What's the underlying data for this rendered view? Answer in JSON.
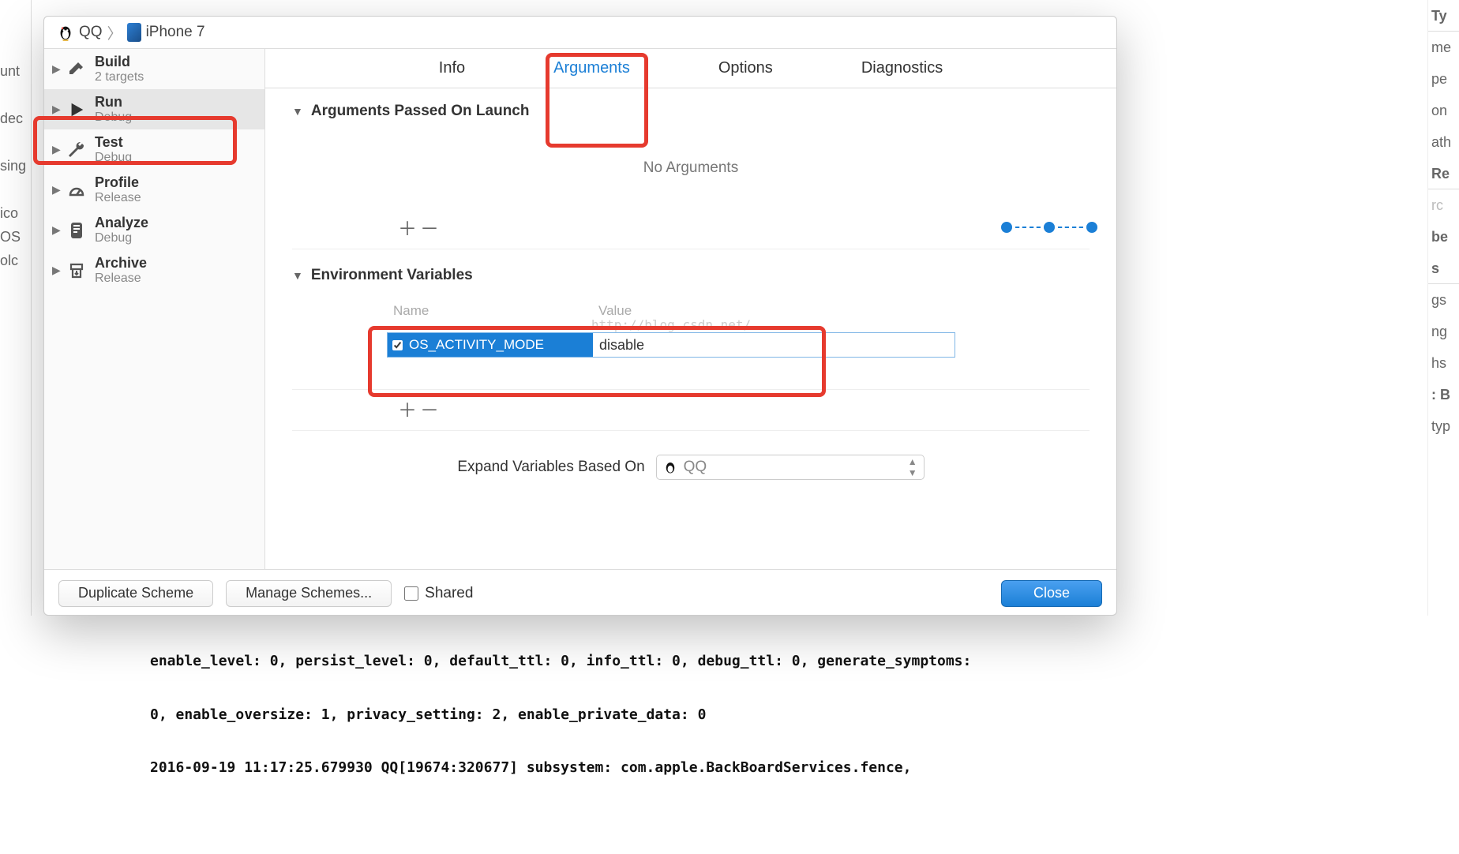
{
  "bg_left": [
    "unt",
    "dec",
    "sing",
    "ico",
    "OS",
    "olc"
  ],
  "bg_right": [
    "Ty",
    "me",
    "pe",
    "on",
    "ath",
    "Re",
    "rc",
    "be",
    "s",
    "gs",
    "ng",
    "hs",
    ": B",
    "typ"
  ],
  "breadcrumb": {
    "scheme": "QQ",
    "device": "iPhone 7"
  },
  "sidebar": {
    "items": [
      {
        "title": "Build",
        "subtitle": "2 targets",
        "icon": "hammer-icon"
      },
      {
        "title": "Run",
        "subtitle": "Debug",
        "icon": "play-icon"
      },
      {
        "title": "Test",
        "subtitle": "Debug",
        "icon": "wrench-icon"
      },
      {
        "title": "Profile",
        "subtitle": "Release",
        "icon": "gauge-icon"
      },
      {
        "title": "Analyze",
        "subtitle": "Debug",
        "icon": "analyze-icon"
      },
      {
        "title": "Archive",
        "subtitle": "Release",
        "icon": "archive-icon"
      }
    ],
    "selected_index": 1
  },
  "tabs": {
    "items": [
      "Info",
      "Arguments",
      "Options",
      "Diagnostics"
    ],
    "active_index": 1
  },
  "sections": {
    "args_launch": {
      "title": "Arguments Passed On Launch",
      "empty_text": "No Arguments"
    },
    "env_vars": {
      "title": "Environment Variables",
      "columns": [
        "Name",
        "Value"
      ],
      "rows": [
        {
          "enabled": true,
          "name": "OS_ACTIVITY_MODE",
          "value": "disable"
        }
      ]
    }
  },
  "watermark": "http://blog.csdn.net/",
  "expand": {
    "label": "Expand Variables Based On",
    "value": "QQ"
  },
  "footer": {
    "duplicate": "Duplicate Scheme",
    "manage": "Manage Schemes...",
    "shared": "Shared",
    "close": "Close"
  },
  "console_lines": [
    "enable_level: 0, persist_level: 0, default_ttl: 0, info_ttl: 0, debug_ttl: 0, generate_symptoms:",
    "0, enable_oversize: 1, privacy_setting: 2, enable_private_data: 0",
    "2016-09-19 11:17:25.679930 QQ[19674:320677] subsystem: com.apple.BackBoardServices.fence,"
  ]
}
